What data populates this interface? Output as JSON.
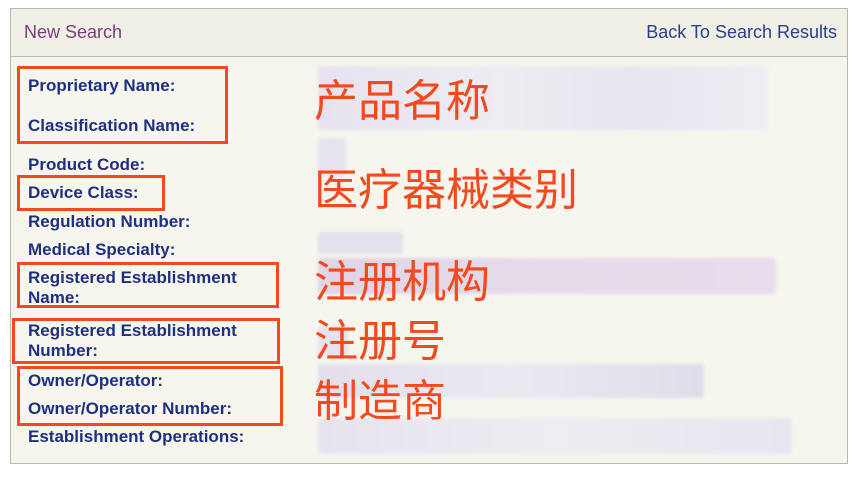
{
  "header": {
    "new_search": "New Search",
    "back_to_results": "Back To Search Results"
  },
  "fields": [
    "Proprietary Name:",
    "Classification Name:",
    "Product Code:",
    "Device Class:",
    "Regulation Number:",
    "Medical Specialty:",
    "Registered Establishment Name:",
    "Registered Establishment Number:",
    "Owner/Operator:",
    "Owner/Operator Number:",
    "Establishment Operations:"
  ],
  "annotations": {
    "product_name": "产品名称",
    "device_category": "医疗器械类别",
    "registered_org": "注册机构",
    "registration_no": "注册号",
    "manufacturer": "制造商"
  },
  "colors": {
    "annotation": "#f24a1e",
    "label": "#1f2f82"
  }
}
